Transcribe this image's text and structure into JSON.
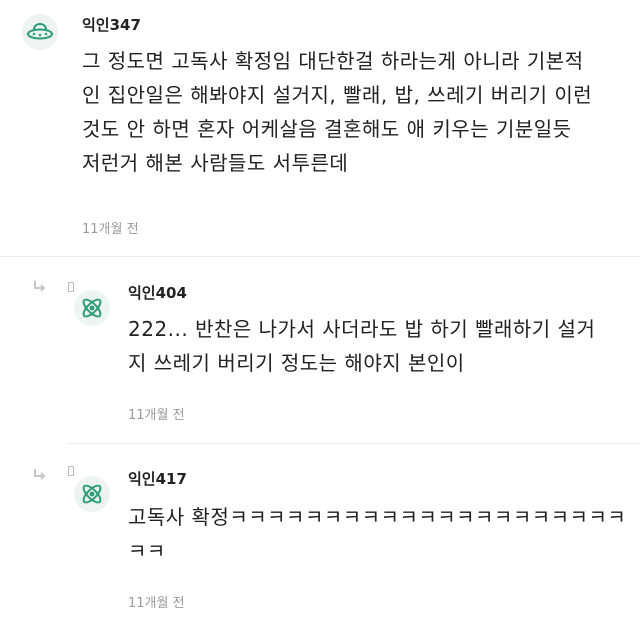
{
  "comments": [
    {
      "author": "익인347",
      "lines": [
        "그 정도면 고독사 확정임 대단한걸 하라는게 아니라 기본적",
        "인 집안일은 해봐야지 설거지, 빨래, 밥, 쓰레기 버리기 이런",
        "것도 안 하면 혼자 어케살음 결혼해도 애 키우는 기분일듯",
        "저런거 해본 사람들도 서투른데"
      ],
      "time": "11개월 전",
      "avatar_icon": "ufo-icon"
    },
    {
      "author": "익인404",
      "lines": [
        "222... 반찬은 나가서 사더라도 밥 하기 빨래하기 설거",
        "지 쓰레기 버리기 정도는 해야지 본인이"
      ],
      "time": "11개월 전",
      "avatar_icon": "atom-icon",
      "reply_icon": "reply-arrow-icon"
    },
    {
      "author": "익인417",
      "lines": [
        "고독사 확정ㅋㅋㅋㅋㅋㅋㅋㅋㅋㅋㅋㅋㅋㅋㅋㅋㅋㅋㅋㅋㅋ",
        "ㅋㅋ"
      ],
      "time": "11개월 전",
      "avatar_icon": "atom-icon",
      "reply_icon": "reply-arrow-icon"
    }
  ],
  "colors": {
    "accent": "#2e9c7a",
    "time": "#9a9a9a",
    "divider": "#ececec"
  }
}
